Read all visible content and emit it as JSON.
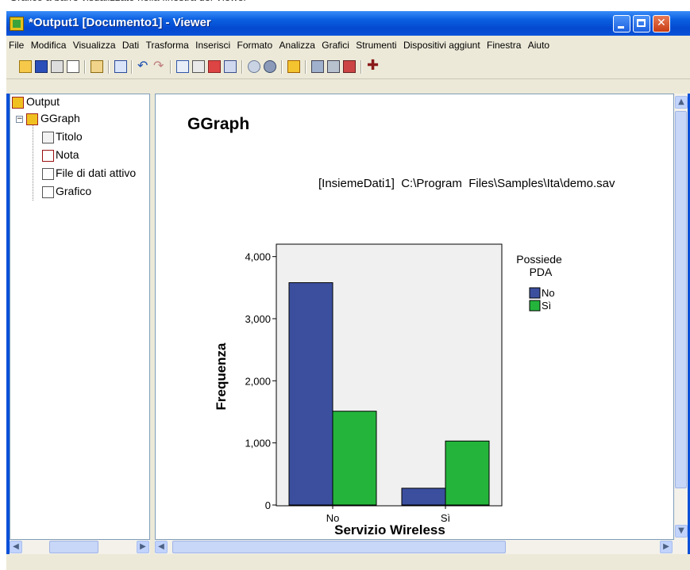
{
  "caption": "Grafico a barre visualizzato nella finestra del Viewer",
  "window": {
    "title": "*Output1 [Documento1] - Viewer"
  },
  "menu": [
    "File",
    "Modifica",
    "Visualizza",
    "Dati",
    "Trasforma",
    "Inserisci",
    "Formato",
    "Analizza",
    "Grafici",
    "Strumenti",
    "Dispositivi aggiunt",
    "Finestra",
    "Aiuto"
  ],
  "toolbar_icons": [
    "open-icon",
    "save-icon",
    "print-icon",
    "print-preview-icon",
    "export-icon",
    "dialog-recall-icon",
    "undo-icon",
    "redo-icon",
    "goto-data-icon",
    "goto-case-icon",
    "variables-icon",
    "select-icon",
    "designate-window-icon",
    "insert-heading-icon",
    "show-icon",
    "hide-icon",
    "promote-icon",
    "insert-title-icon",
    "insert-text-icon",
    "insert-chart-icon",
    "plus-icon"
  ],
  "outline": {
    "root": "Output",
    "group": "GGraph",
    "items": [
      "Titolo",
      "Nota",
      "File di dati attivo",
      "Grafico"
    ]
  },
  "content": {
    "heading": "GGraph",
    "dataset": "[InsiemeDati1]  C:\\Program  Files\\Samples\\Ita\\demo.sav"
  },
  "colors": {
    "no": "#3c4f9f",
    "si": "#24b43c",
    "plot_bg": "#f0f0f0"
  },
  "chart_data": {
    "type": "bar",
    "categories": [
      "No",
      "Sì"
    ],
    "series": [
      {
        "name": "No",
        "values": [
          3580,
          270
        ]
      },
      {
        "name": "Sì",
        "values": [
          1510,
          1030
        ]
      }
    ],
    "xlabel": "Servizio Wireless",
    "ylabel": "Frequenza",
    "legend_title": "Possiede PDA",
    "ylim": [
      0,
      4200
    ],
    "yticks": [
      "0",
      "1,000",
      "2,000",
      "3,000",
      "4,000"
    ],
    "ytick_values": [
      0,
      1000,
      2000,
      3000,
      4000
    ],
    "legend": "right"
  }
}
